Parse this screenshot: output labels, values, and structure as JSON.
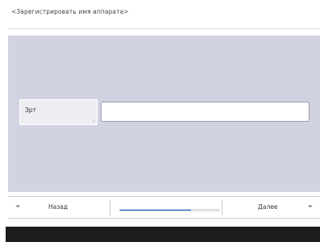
{
  "screen": {
    "title": "<Зарегистрировать имя аппарата>"
  },
  "form": {
    "field_label": "Зрт",
    "field_marker": "›",
    "field_value": ""
  },
  "navigation": {
    "back_label": "Назад",
    "back_icon": "left-triangle-icon",
    "back_glyph": "◄",
    "next_label": "Далее",
    "next_icon": "right-triangle-icon",
    "next_glyph": "►",
    "progress_fraction": 0.72
  },
  "colors": {
    "panel_background": "#d2d3e1",
    "progress_accent": "#2f78d6",
    "bottom_strip": "#1d1d1f"
  }
}
